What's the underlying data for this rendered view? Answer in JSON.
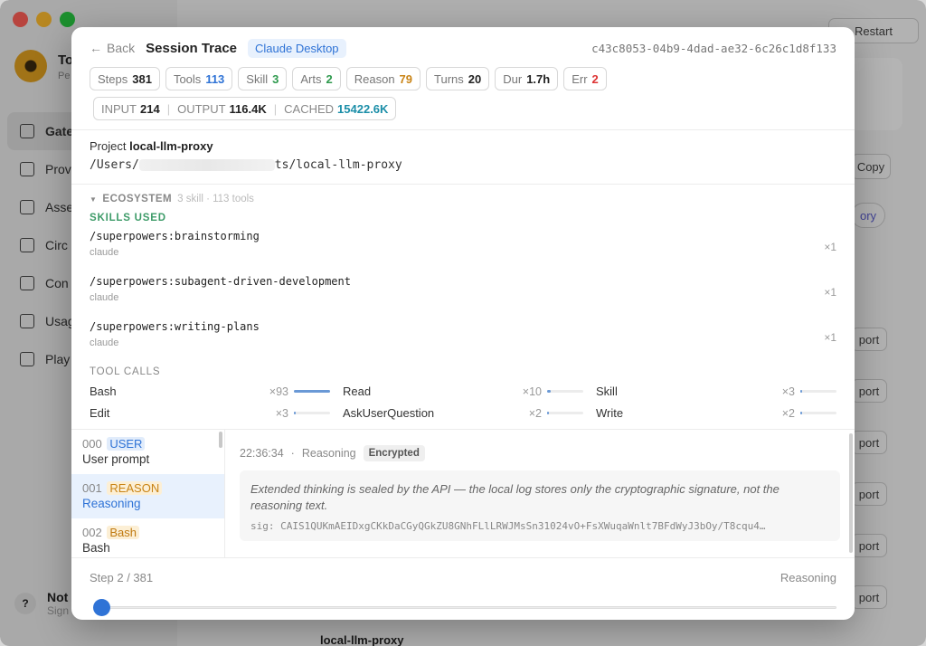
{
  "background": {
    "user_name": "To",
    "user_sub": "Pe",
    "nav": [
      "Gate",
      "Prov",
      "Asse",
      "Circ",
      "Con",
      "Usag",
      "Play"
    ],
    "bottom_title": "Not",
    "bottom_sub": "Sign",
    "bottom_q": "?",
    "restart_label": "Restart",
    "copy_label": "Copy",
    "history_label": "ory",
    "export_label": "port",
    "bottom_row": "local-llm-proxy"
  },
  "modal": {
    "back_label": "Back",
    "title": "Session Trace",
    "source_badge": "Claude Desktop",
    "session_id": "c43c8053-04b9-4dad-ae32-6c26c1d8f133",
    "stats": [
      {
        "label": "Steps",
        "value": "381",
        "color": "default"
      },
      {
        "label": "Tools",
        "value": "113",
        "color": "blue"
      },
      {
        "label": "Skill",
        "value": "3",
        "color": "green"
      },
      {
        "label": "Arts",
        "value": "2",
        "color": "green"
      },
      {
        "label": "Reason",
        "value": "79",
        "color": "orange"
      },
      {
        "label": "Turns",
        "value": "20",
        "color": "default"
      },
      {
        "label": "Dur",
        "value": "1.7h",
        "color": "default"
      },
      {
        "label": "Err",
        "value": "2",
        "color": "red"
      }
    ],
    "tokens": {
      "input_label": "INPUT",
      "input_value": "214",
      "output_label": "OUTPUT",
      "output_value": "116.4K",
      "cached_label": "CACHED",
      "cached_value": "15422.6K"
    },
    "project": {
      "label": "Project",
      "name": "local-llm-proxy",
      "path_prefix": "/Users/",
      "path_suffix": "ts/local-llm-proxy"
    },
    "ecosystem": {
      "title": "ECOSYSTEM",
      "summary": "3 skill · 113 tools",
      "skills_label": "SKILLS USED",
      "skills": [
        {
          "name": "/superpowers:brainstorming",
          "source": "claude",
          "count": "×1"
        },
        {
          "name": "/superpowers:subagent-driven-development",
          "source": "claude",
          "count": "×1"
        },
        {
          "name": "/superpowers:writing-plans",
          "source": "claude",
          "count": "×1"
        }
      ],
      "tools_label": "TOOL CALLS",
      "tools": [
        {
          "name": "Bash",
          "count": "×93",
          "fill": 1.0
        },
        {
          "name": "Read",
          "count": "×10",
          "fill": 0.11
        },
        {
          "name": "Skill",
          "count": "×3",
          "fill": 0.03
        },
        {
          "name": "Edit",
          "count": "×3",
          "fill": 0.03
        },
        {
          "name": "AskUserQuestion",
          "count": "×2",
          "fill": 0.02
        },
        {
          "name": "Write",
          "count": "×2",
          "fill": 0.02
        }
      ]
    },
    "steps": [
      {
        "num": "000",
        "tag": "USER",
        "tag_class": "user",
        "label": "User prompt",
        "active": false
      },
      {
        "num": "001",
        "tag": "REASON",
        "tag_class": "reason",
        "label": "Reasoning",
        "active": true
      },
      {
        "num": "002",
        "tag": "Bash",
        "tag_class": "bash",
        "label": "Bash",
        "active": false
      }
    ],
    "detail": {
      "time": "22:36:34",
      "kind": "Reasoning",
      "badge": "Encrypted",
      "message": "Extended thinking is sealed by the API — the local log stores only the cryptographic signature, not the reasoning text.",
      "signature": "sig: CAIS1QUKmAEIDxgCKkDaCGyQGkZU8GNhFLlLRWJMsSn31024vO+FsXWuqaWnlt7BFdWyJ3bOy/T8cqu4…"
    },
    "footer": {
      "step_text": "Step 2 / 381",
      "step_kind": "Reasoning",
      "progress": 0.0026
    }
  }
}
